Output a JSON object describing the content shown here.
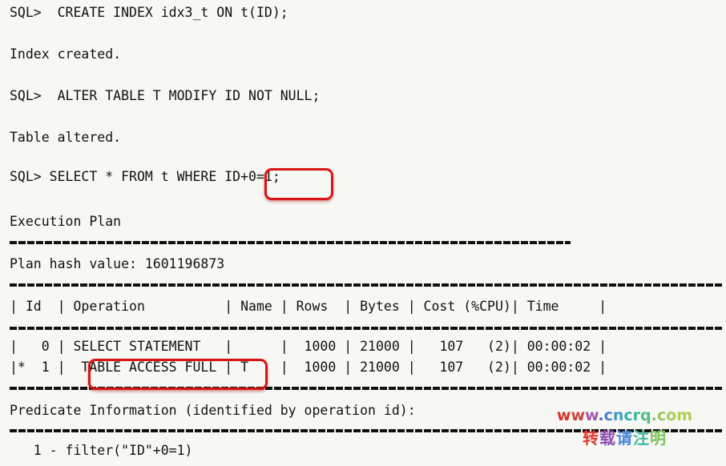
{
  "terminal": {
    "background_color": "#f7f7f4",
    "text_color": "#111111",
    "highlight_color": "#d81515",
    "lines": [
      {
        "id": "cmd-create-index",
        "text": "SQL>  CREATE INDEX idx3_t ON t(ID);"
      },
      {
        "id": "out-index-created",
        "text": "Index created."
      },
      {
        "id": "cmd-alter-table",
        "text": "SQL>  ALTER TABLE T MODIFY ID NOT NULL;"
      },
      {
        "id": "out-table-altered",
        "text": "Table altered."
      },
      {
        "id": "cmd-select",
        "text": "SQL> SELECT * FROM t WHERE ID+0=1;"
      },
      {
        "id": "hdr-execution-plan",
        "text": "Execution Plan"
      },
      {
        "id": "plan-hash",
        "text": "Plan hash value: 1601196873"
      },
      {
        "id": "plan-table-header",
        "text": "| Id  | Operation          | Name | Rows  | Bytes | Cost (%CPU)| Time     |"
      },
      {
        "id": "plan-row-0",
        "text": "|   0 | SELECT STATEMENT   |      |  1000 | 21000 |   107   (2)| 00:00:02 |"
      },
      {
        "id": "plan-row-1",
        "text": "|*  1 |  TABLE ACCESS FULL | T    |  1000 | 21000 |   107   (2)| 00:00:02 |"
      },
      {
        "id": "predicate-header",
        "text": "Predicate Information (identified by operation id):"
      },
      {
        "id": "predicate-1",
        "text": "   1 - filter(\"ID\"+0=1)"
      }
    ],
    "rules": [
      {
        "id": "rule-above-hash",
        "label": "-------------------------------------------------------"
      },
      {
        "id": "rule-below-hash",
        "label": "----------------------------------------------------------------------------"
      },
      {
        "id": "rule-below-header",
        "label": "----------------------------------------------------------------------------"
      },
      {
        "id": "rule-below-rows",
        "label": "----------------------------------------------------------------------------"
      },
      {
        "id": "rule-predicate",
        "label": "----------------------------------------------------------------------------"
      }
    ],
    "highlights": [
      {
        "id": "highlight-predicate-expression",
        "label": "ID+0=1"
      },
      {
        "id": "highlight-table-access-full",
        "label": "TABLE ACCESS FULL"
      }
    ]
  },
  "watermark": {
    "url_chars": [
      {
        "ch": "w",
        "color": "#d8352a"
      },
      {
        "ch": "w",
        "color": "#c9463f"
      },
      {
        "ch": "w",
        "color": "#a05aa8"
      },
      {
        "ch": ".",
        "color": "#5b60c4"
      },
      {
        "ch": "c",
        "color": "#4f7fd0"
      },
      {
        "ch": "n",
        "color": "#3f9ec0"
      },
      {
        "ch": "c",
        "color": "#35b0ae"
      },
      {
        "ch": "r",
        "color": "#39b89a"
      },
      {
        "ch": "q",
        "color": "#55bd86"
      },
      {
        "ch": ".",
        "color": "#7cc471"
      },
      {
        "ch": "c",
        "color": "#93c95f"
      },
      {
        "ch": "o",
        "color": "#a7cd58"
      },
      {
        "ch": "m",
        "color": "#aed04f"
      }
    ],
    "cn_chars": [
      {
        "ch": "转",
        "color": "#e0392c"
      },
      {
        "ch": "载",
        "color": "#8e4fb2"
      },
      {
        "ch": "请",
        "color": "#4a86d4"
      },
      {
        "ch": "注",
        "color": "#3ebba2"
      },
      {
        "ch": "明",
        "color": "#7fc45c"
      }
    ],
    "url_text": "www.cncrq.com",
    "cn_text": "转载请注明"
  }
}
